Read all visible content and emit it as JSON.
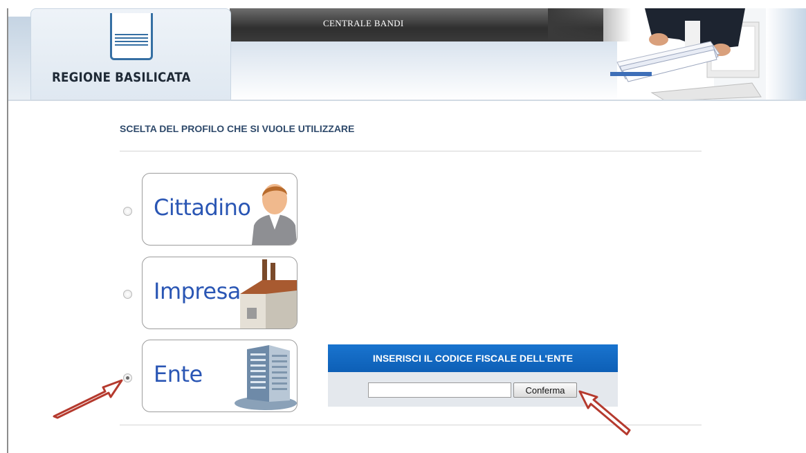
{
  "header": {
    "site_title": "CENTRALE BANDI",
    "brand": "REGIONE BASILICATA",
    "logo_icon": "basilicata-emblem-icon",
    "illustration": "handing-documents-illustration"
  },
  "profile_selection": {
    "title": "SCELTA DEL PROFILO CHE SI VUOLE UTILIZZARE",
    "options": [
      {
        "label": "Cittadino",
        "icon": "person-icon",
        "selected": false
      },
      {
        "label": "Impresa",
        "icon": "factory-icon",
        "selected": false
      },
      {
        "label": "Ente",
        "icon": "office-building-icon",
        "selected": true
      }
    ]
  },
  "ente_panel": {
    "heading": "INSERISCI IL CODICE FISCALE DELL'ENTE",
    "input_value": "",
    "confirm_label": "Conferma"
  },
  "annotations": {
    "arrow_color": "#b53a2e"
  },
  "colors": {
    "accent_blue": "#0d5fb6",
    "title_blue": "#2f4a6b",
    "option_label_blue": "#2a56b4"
  }
}
